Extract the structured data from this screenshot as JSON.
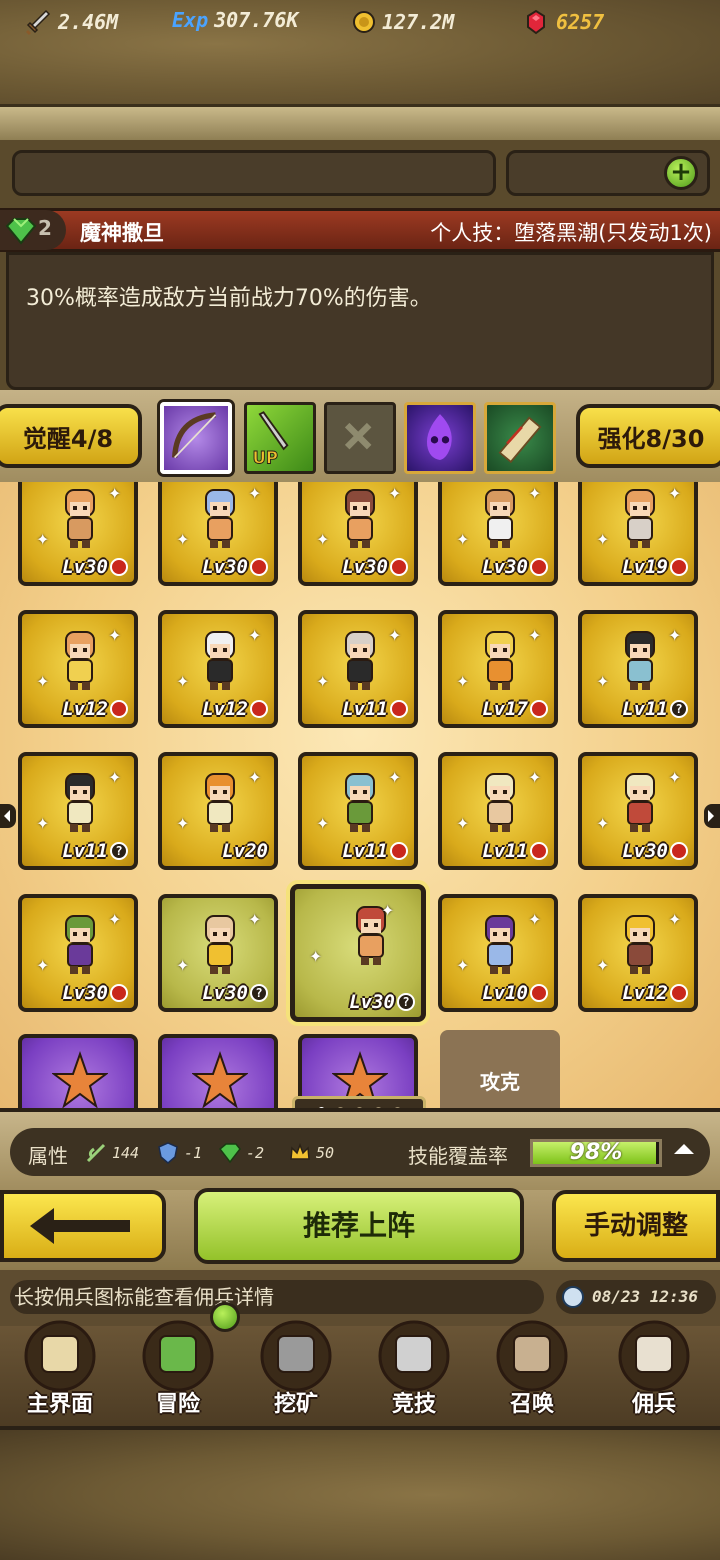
{
  "resources": {
    "attack": "2.46M",
    "exp_icon_label": "Exp",
    "exp": "307.76K",
    "gold": "127.2M",
    "gems": "6257",
    "add_label": "+"
  },
  "skill": {
    "gem_count": "2",
    "name": "魔神撒旦",
    "personal_skill": "个人技：堕落黑潮(只发动1次)",
    "description": "30%概率造成敌方当前战力70%的伤害。"
  },
  "mid": {
    "awaken_label": "觉醒4/8",
    "enhance_label": "强化8/30",
    "up_badge": "UP"
  },
  "cards": [
    {
      "lv": "Lv30",
      "badge": "red",
      "tone": "gold"
    },
    {
      "lv": "Lv30",
      "badge": "red",
      "tone": "gold"
    },
    {
      "lv": "Lv30",
      "badge": "red",
      "tone": "gold"
    },
    {
      "lv": "Lv30",
      "badge": "red",
      "tone": "gold"
    },
    {
      "lv": "Lv19",
      "badge": "red",
      "tone": "gold"
    },
    {
      "lv": "Lv12",
      "badge": "red",
      "tone": "gold"
    },
    {
      "lv": "Lv12",
      "badge": "red",
      "tone": "gold"
    },
    {
      "lv": "Lv11",
      "badge": "red",
      "tone": "gold"
    },
    {
      "lv": "Lv17",
      "badge": "red",
      "tone": "gold"
    },
    {
      "lv": "Lv11",
      "badge": "q",
      "tone": "gold"
    },
    {
      "lv": "Lv11",
      "badge": "q",
      "tone": "gold"
    },
    {
      "lv": "Lv20",
      "badge": "none",
      "tone": "gold"
    },
    {
      "lv": "Lv11",
      "badge": "red",
      "tone": "gold"
    },
    {
      "lv": "Lv11",
      "badge": "red",
      "tone": "gold"
    },
    {
      "lv": "Lv30",
      "badge": "red",
      "tone": "gold"
    },
    {
      "lv": "Lv30",
      "badge": "red",
      "tone": "gold"
    },
    {
      "lv": "Lv30",
      "badge": "q",
      "tone": "green"
    },
    {
      "lv": "Lv30",
      "badge": "q",
      "tone": "green"
    },
    {
      "lv": "Lv10",
      "badge": "red",
      "tone": "gold"
    },
    {
      "lv": "Lv12",
      "badge": "red",
      "tone": "gold"
    }
  ],
  "locked_card": "攻克",
  "pager": {
    "total": 5,
    "current": 1
  },
  "attributes": {
    "label": "属性",
    "a1": "144",
    "a2": "-1",
    "a3": "-2",
    "a4": "50",
    "coverage_label": "技能覆盖率",
    "coverage": "98%",
    "coverage_fraction": 0.98
  },
  "buttons": {
    "recommend": "推荐上阵",
    "manual": "手动调整"
  },
  "tip": "长按佣兵图标能查看佣兵详情",
  "time": "08/23 12:36",
  "nav": [
    {
      "label": "主界面",
      "icon": "map-scroll-icon"
    },
    {
      "label": "冒险",
      "icon": "island-icon"
    },
    {
      "label": "挖矿",
      "icon": "pickaxe-icon"
    },
    {
      "label": "竞技",
      "icon": "crossed-swords-icon"
    },
    {
      "label": "召唤",
      "icon": "summon-scroll-icon"
    },
    {
      "label": "佣兵",
      "icon": "tent-icon"
    }
  ],
  "colors": {
    "gold_card": "#d9aa1b",
    "purple_card": "#7a3fc2",
    "accent_green": "#94c22a",
    "yellow_button": "#f8e04a"
  }
}
